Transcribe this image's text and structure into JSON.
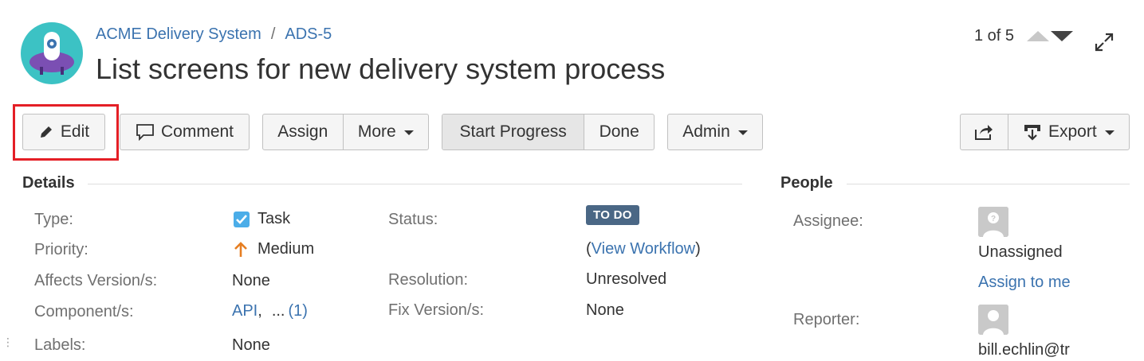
{
  "header": {
    "project": "ACME Delivery System",
    "separator": "/",
    "issue_key": "ADS-5",
    "title": "List screens for new delivery system process",
    "pager": "1 of 5"
  },
  "toolbar": {
    "edit": "Edit",
    "comment": "Comment",
    "assign": "Assign",
    "more": "More",
    "start_progress": "Start Progress",
    "done": "Done",
    "admin": "Admin",
    "export": "Export"
  },
  "details": {
    "heading": "Details",
    "type_label": "Type:",
    "type_value": "Task",
    "priority_label": "Priority:",
    "priority_value": "Medium",
    "affects_label": "Affects Version/s:",
    "affects_value": "None",
    "component_label": "Component/s:",
    "component_value": "API",
    "component_comma": ",",
    "component_more": "...",
    "component_more_count": "(1)",
    "labels_label": "Labels:",
    "labels_value": "None",
    "status_label": "Status:",
    "status_value": "TO DO",
    "workflow_open": "(",
    "workflow_link": "View Workflow",
    "workflow_close": ")",
    "resolution_label": "Resolution:",
    "resolution_value": "Unresolved",
    "fix_label": "Fix Version/s:",
    "fix_value": "None"
  },
  "people": {
    "heading": "People",
    "assignee_label": "Assignee:",
    "assignee_value": "Unassigned",
    "assign_to_me": "Assign to me",
    "reporter_label": "Reporter:",
    "reporter_value": "bill.echlin@tr"
  },
  "colors": {
    "link": "#3b73af",
    "highlight": "#e41f26",
    "status_lozenge": "#4a6785",
    "priority_arrow": "#e67e22",
    "task_checkbox": "#4bade8"
  }
}
